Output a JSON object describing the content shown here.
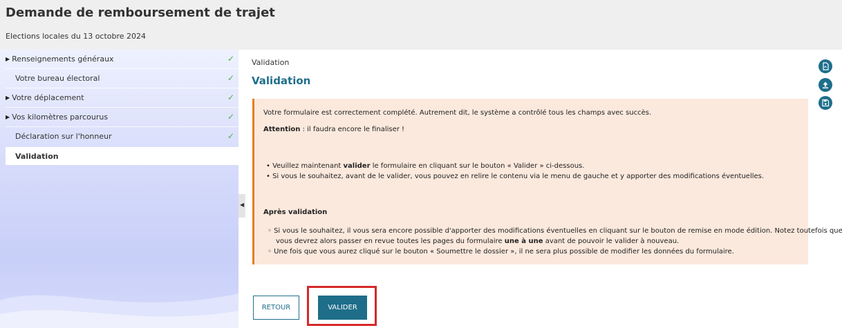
{
  "header": {
    "title": "Demande de remboursement de trajet",
    "subtitle": "Elections locales du 13 octobre 2024"
  },
  "sidebar": {
    "items": [
      {
        "label": "Renseignements généraux",
        "expandable": true,
        "completed": true
      },
      {
        "label": "Votre bureau électoral",
        "expandable": false,
        "completed": true
      },
      {
        "label": "Votre déplacement",
        "expandable": true,
        "completed": true
      },
      {
        "label": "Vos kilomètres parcourus",
        "expandable": true,
        "completed": true
      },
      {
        "label": "Déclaration sur l'honneur",
        "expandable": false,
        "completed": true
      },
      {
        "label": "Validation",
        "expandable": false,
        "completed": false,
        "active": true
      }
    ],
    "check_glyph": "✓",
    "arrow_glyph": "▶"
  },
  "main": {
    "breadcrumb": "Validation",
    "title": "Validation",
    "notice": {
      "line1": "Votre formulaire est correctement complété. Autrement dit, le système a contrôlé tous les champs avec succès.",
      "attention_bold": "Attention",
      "attention_rest": " : il faudra encore le finaliser !",
      "bullet1_pre": "• Veuillez maintenant ",
      "bullet1_bold": "valider",
      "bullet1_post": " le formulaire en cliquant sur le bouton « Valider » ci-dessous.",
      "bullet2": "• Si vous le souhaitez, avant de le valider, vous pouvez en relire le contenu via le menu de gauche et y apporter des modifications éventuelles.",
      "after_title": "Après validation",
      "after1_line1": "◦ Si vous le souhaitez, il vous sera encore possible d'apporter des modifications éventuelles en cliquant sur le bouton de remise en mode édition. Notez toutefois que",
      "after1_line2_pre": "vous devrez alors passer en revue toutes les pages du formulaire ",
      "after1_line2_bold": "une à une",
      "after1_line2_post": " avant de pouvoir le valider à nouveau.",
      "after2": "◦ Une fois que vous aurez cliqué sur le bouton « Soumettre le dossier », il ne sera plus possible de modifier les données du formulaire."
    },
    "buttons": {
      "retour": "RETOUR",
      "valider": "VALIDER"
    }
  },
  "tools": [
    {
      "icon": "pdf-icon"
    },
    {
      "icon": "upload-icon"
    },
    {
      "icon": "save-icon"
    }
  ],
  "colors": {
    "accent": "#1f6f8b",
    "notice_bg": "#fbe9dd",
    "notice_border": "#e67e22",
    "highlight": "#d62828",
    "check": "#4caf50"
  }
}
